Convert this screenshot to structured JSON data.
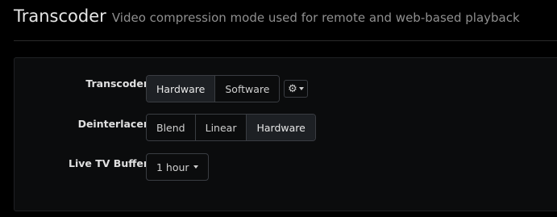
{
  "header": {
    "title": "Transcoder",
    "subtitle": "Video compression mode used for remote and web-based playback"
  },
  "settings": {
    "transcoder": {
      "label": "Transcoder",
      "options": [
        "Hardware",
        "Software"
      ],
      "selected": "Hardware",
      "settings_icon": "gear-icon"
    },
    "deinterlacer": {
      "label": "Deinterlacer",
      "options": [
        "Blend",
        "Linear",
        "Hardware"
      ],
      "selected": "Hardware"
    },
    "live_tv_buffer": {
      "label": "Live TV Buffer",
      "value": "1 hour"
    }
  },
  "colors": {
    "background": "#000000",
    "panel": "#0b0c0d",
    "active_button": "#1d2024",
    "border": "#3a3d42"
  }
}
